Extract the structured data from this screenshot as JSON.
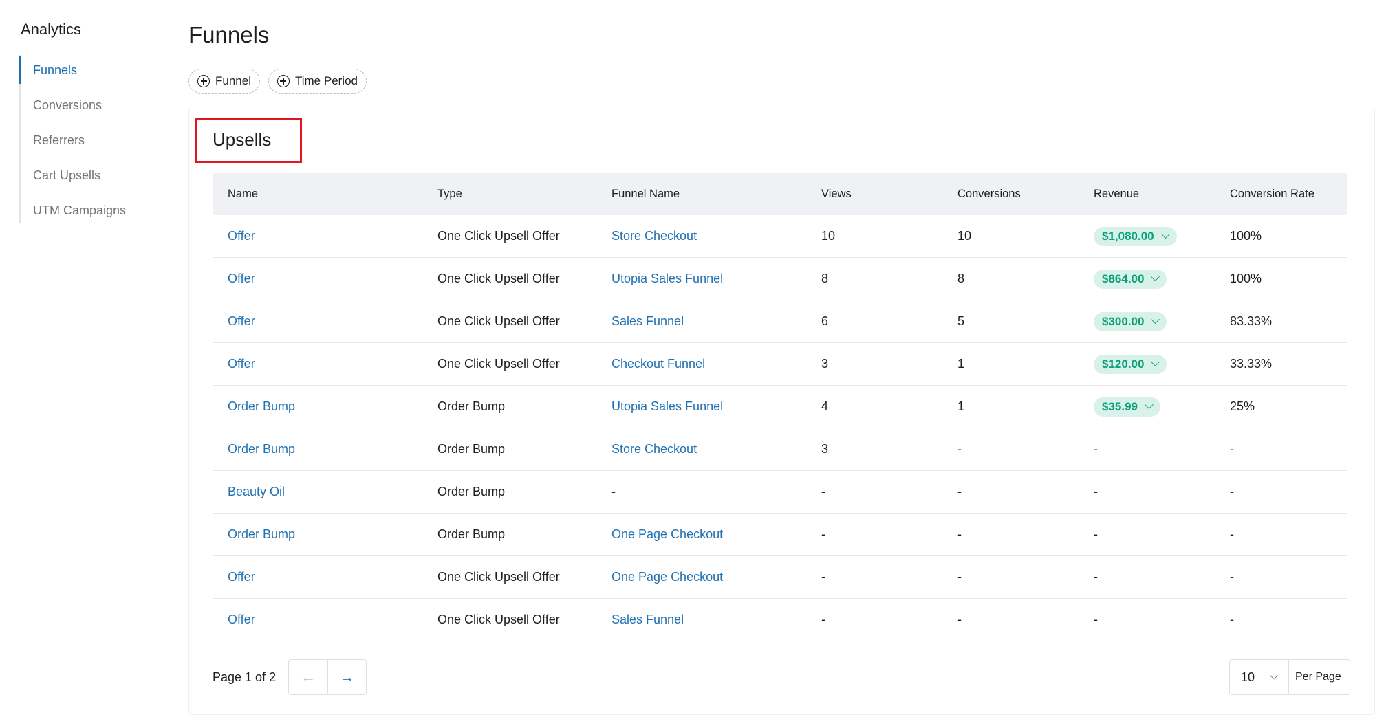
{
  "sidebar": {
    "title": "Analytics",
    "items": [
      {
        "label": "Funnels",
        "active": true
      },
      {
        "label": "Conversions"
      },
      {
        "label": "Referrers"
      },
      {
        "label": "Cart Upsells"
      },
      {
        "label": "UTM Campaigns"
      }
    ]
  },
  "page": {
    "title": "Funnels",
    "filters": [
      "Funnel",
      "Time Period"
    ]
  },
  "card": {
    "title": "Upsells",
    "columns": [
      "Name",
      "Type",
      "Funnel Name",
      "Views",
      "Conversions",
      "Revenue",
      "Conversion Rate"
    ],
    "rows": [
      {
        "name": "Offer",
        "type": "One Click Upsell Offer",
        "funnel": "Store Checkout",
        "views": "10",
        "conversions": "10",
        "revenue": "$1,080.00",
        "rate": "100%"
      },
      {
        "name": "Offer",
        "type": "One Click Upsell Offer",
        "funnel": "Utopia Sales Funnel",
        "views": "8",
        "conversions": "8",
        "revenue": "$864.00",
        "rate": "100%"
      },
      {
        "name": "Offer",
        "type": "One Click Upsell Offer",
        "funnel": "Sales Funnel",
        "views": "6",
        "conversions": "5",
        "revenue": "$300.00",
        "rate": "83.33%"
      },
      {
        "name": "Offer",
        "type": "One Click Upsell Offer",
        "funnel": "Checkout Funnel",
        "views": "3",
        "conversions": "1",
        "revenue": "$120.00",
        "rate": "33.33%"
      },
      {
        "name": "Order Bump",
        "type": "Order Bump",
        "funnel": "Utopia Sales Funnel",
        "views": "4",
        "conversions": "1",
        "revenue": "$35.99",
        "rate": "25%"
      },
      {
        "name": "Order Bump",
        "type": "Order Bump",
        "funnel": "Store Checkout",
        "views": "3",
        "conversions": "-",
        "revenue": "-",
        "rate": "-"
      },
      {
        "name": "Beauty Oil",
        "type": "Order Bump",
        "funnel": "-",
        "views": "-",
        "conversions": "-",
        "revenue": "-",
        "rate": "-"
      },
      {
        "name": "Order Bump",
        "type": "Order Bump",
        "funnel": "One Page Checkout",
        "views": "-",
        "conversions": "-",
        "revenue": "-",
        "rate": "-"
      },
      {
        "name": "Offer",
        "type": "One Click Upsell Offer",
        "funnel": "One Page Checkout",
        "views": "-",
        "conversions": "-",
        "revenue": "-",
        "rate": "-"
      },
      {
        "name": "Offer",
        "type": "One Click Upsell Offer",
        "funnel": "Sales Funnel",
        "views": "-",
        "conversions": "-",
        "revenue": "-",
        "rate": "-"
      }
    ]
  },
  "pagination": {
    "label": "Page 1 of 2",
    "prev_icon": "←",
    "next_icon": "→",
    "per_page_value": "10",
    "per_page_label": "Per Page"
  },
  "colors": {
    "link": "#2271b1",
    "badge_bg": "#d8f2ea",
    "badge_text": "#0aa178",
    "highlight_box": "#e3161c"
  }
}
